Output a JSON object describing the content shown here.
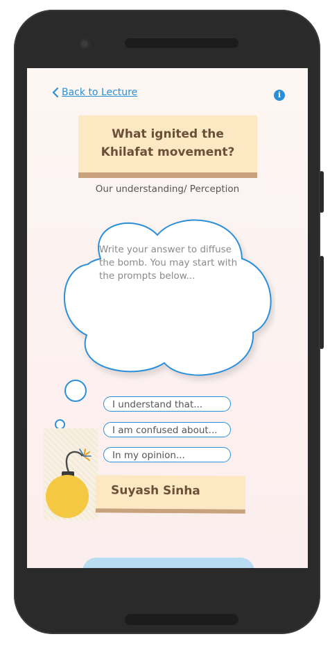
{
  "nav": {
    "back_label": "Back to Lecture"
  },
  "question": {
    "line1": "What ignited the",
    "line2": "Khilafat movement?"
  },
  "subtitle": "Our understanding/ Perception",
  "answer": {
    "placeholder": "Write your answer to diffuse the bomb. You may start with the prompts below..."
  },
  "prompts": [
    "I understand that...",
    "I am confused about...",
    "In my opinion..."
  ],
  "user": {
    "name": "Suyash Sinha"
  },
  "colors": {
    "accent": "#2a8fd8",
    "card": "#fde8c4",
    "card_shadow": "#c8a27c",
    "text_brown": "#6a5038",
    "bomb": "#f4c842"
  }
}
